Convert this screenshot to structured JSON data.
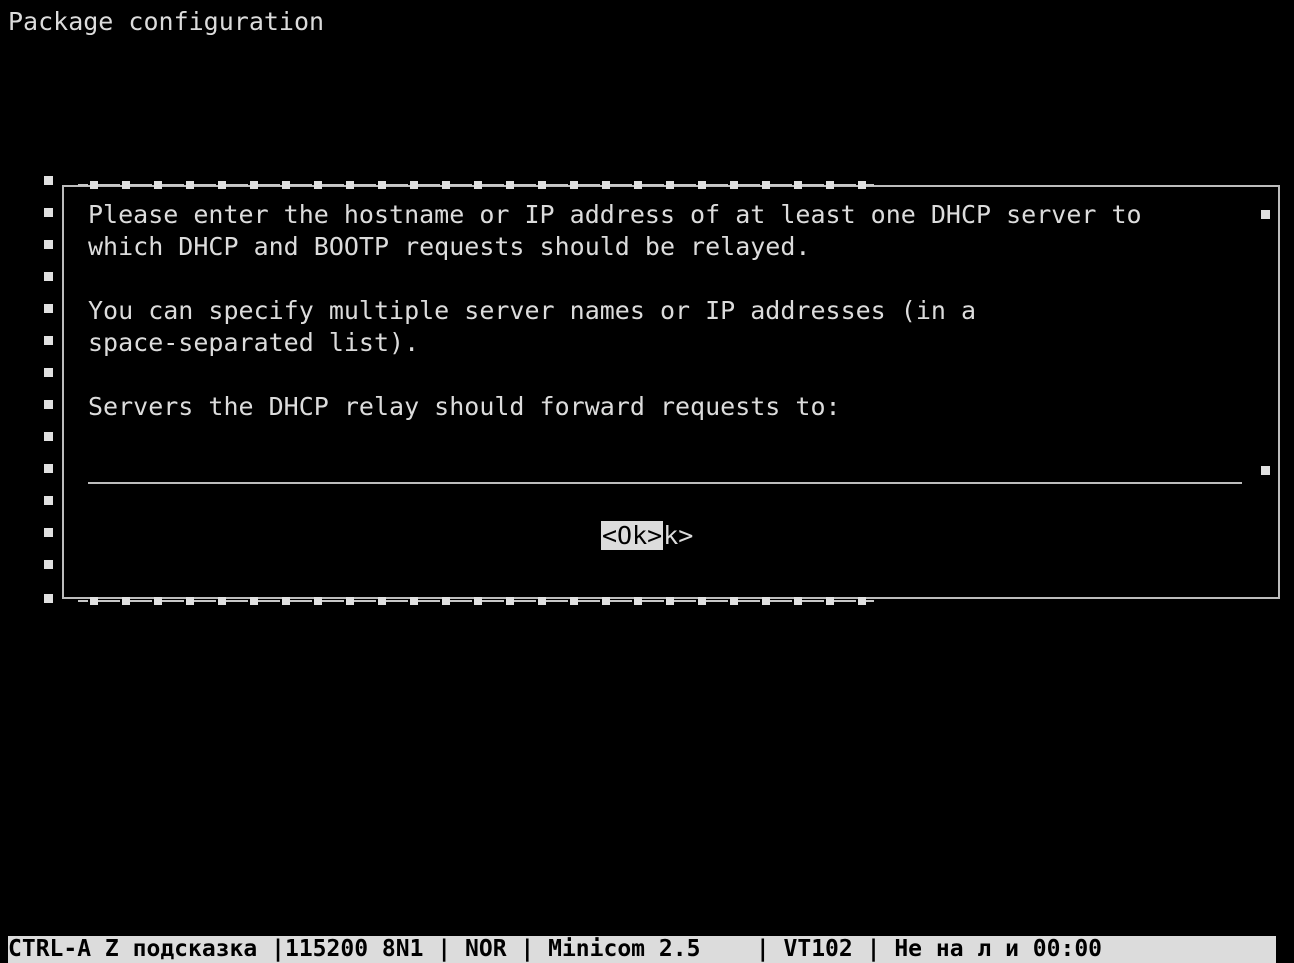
{
  "screen": {
    "title": "Package configuration"
  },
  "dialog": {
    "line1": "Please enter the hostname or IP address of at least one DHCP server to",
    "line2": "which DHCP and BOOTP requests should be relayed.",
    "line3": "You can specify multiple server names or IP addresses (in a",
    "line4": "space-separated list).",
    "prompt": "Servers the DHCP relay should forward requests to:",
    "input_value": "",
    "ok_label": "<Ok>",
    "ok_ghost": "k>"
  },
  "status_bar": {
    "help": "CTRL-A Z подсказка ",
    "sep1": "|",
    "port": "115200 8N1 ",
    "sep2": "| ",
    "mode": "NOR ",
    "sep3": "| ",
    "app": "Minicom 2.5    ",
    "sep4": "| ",
    "term": "VT102 ",
    "sep5": "| ",
    "conn": "Не на л и 00:00"
  },
  "colors": {
    "background": "#000000",
    "text": "#dcdcdc",
    "status_bar_bg": "#dcdcdc"
  }
}
